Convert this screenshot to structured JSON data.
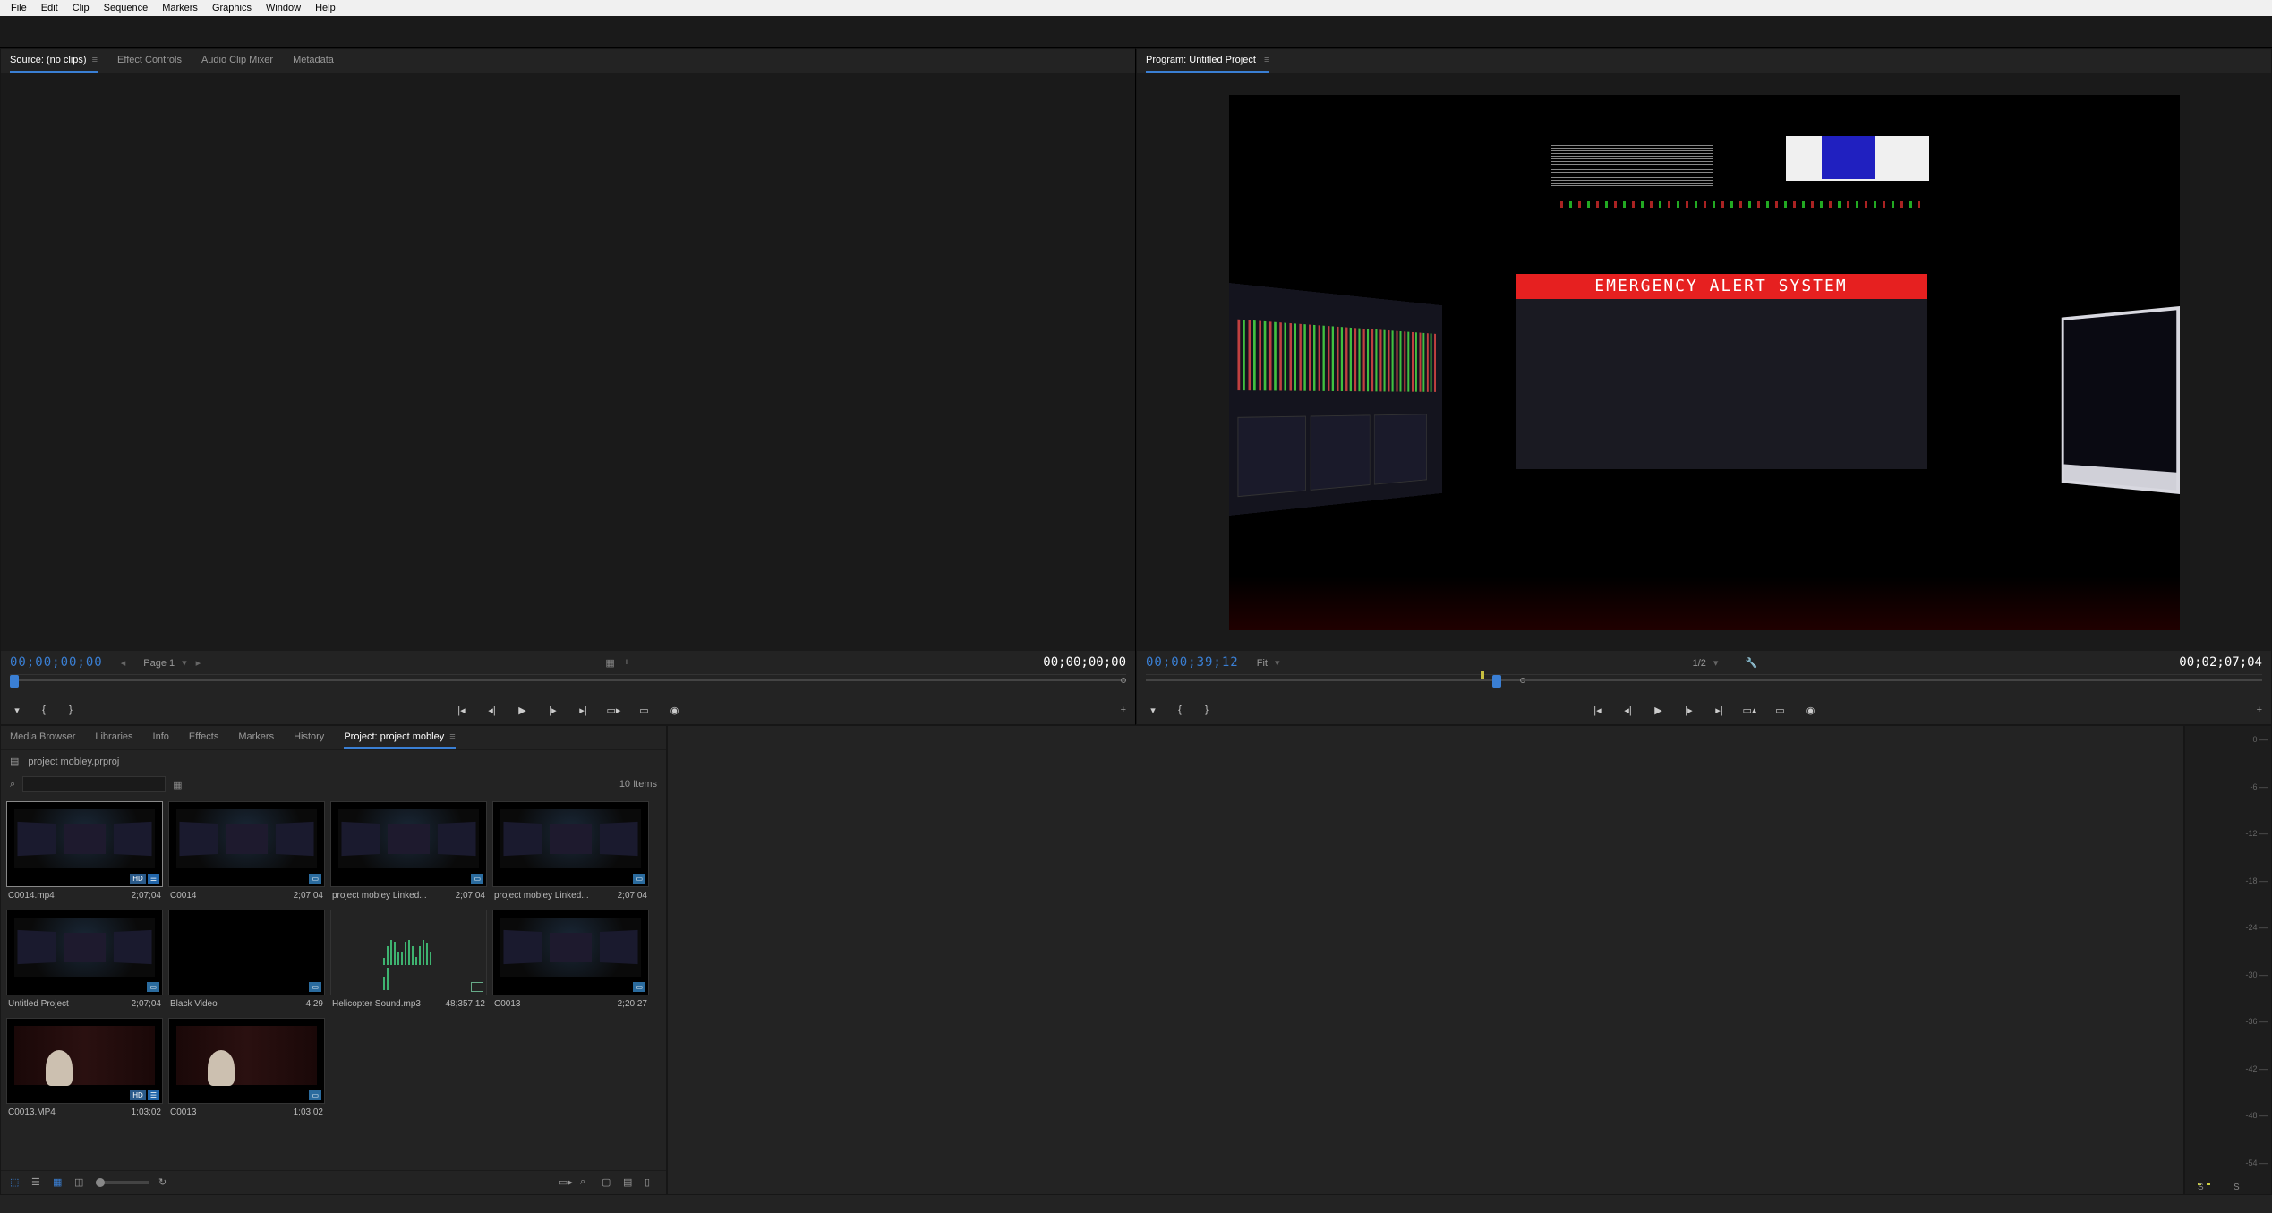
{
  "menubar": [
    "File",
    "Edit",
    "Clip",
    "Sequence",
    "Markers",
    "Graphics",
    "Window",
    "Help"
  ],
  "source_panel": {
    "tabs": [
      {
        "label": "Source: (no clips)",
        "active": true,
        "closeable": true
      },
      {
        "label": "Effect Controls",
        "active": false
      },
      {
        "label": "Audio Clip Mixer",
        "active": false
      },
      {
        "label": "Metadata",
        "active": false
      }
    ],
    "timecode_left": "00;00;00;00",
    "page_label": "Page 1",
    "timecode_right": "00;00;00;00"
  },
  "program_panel": {
    "tab_label": "Program: Untitled Project",
    "timecode_left": "00;00;39;12",
    "fit_label": "Fit",
    "resolution_label": "1/2",
    "timecode_right": "00;02;07;04",
    "alert_text": "EMERGENCY ALERT SYSTEM",
    "playhead_percent": 30
  },
  "lower_tabs": [
    {
      "label": "Media Browser",
      "active": false
    },
    {
      "label": "Libraries",
      "active": false
    },
    {
      "label": "Info",
      "active": false
    },
    {
      "label": "Effects",
      "active": false
    },
    {
      "label": "Markers",
      "active": false
    },
    {
      "label": "History",
      "active": false
    },
    {
      "label": "Project: project mobley",
      "active": true,
      "closeable": true
    }
  ],
  "project": {
    "file_name": "project mobley.prproj",
    "search_placeholder": "",
    "item_count_label": "10 Items",
    "clips": [
      {
        "name": "C0014.mp4",
        "duration": "2;07;04",
        "type": "av",
        "thumb": "scene",
        "selected": true
      },
      {
        "name": "C0014",
        "duration": "2;07;04",
        "type": "seq",
        "thumb": "scene"
      },
      {
        "name": "project mobley Linked...",
        "duration": "2;07;04",
        "type": "seq",
        "thumb": "scene"
      },
      {
        "name": "project mobley Linked...",
        "duration": "2;07;04",
        "type": "seq",
        "thumb": "scene"
      },
      {
        "name": "Untitled Project",
        "duration": "2;07;04",
        "type": "seq",
        "thumb": "scene"
      },
      {
        "name": "Black Video",
        "duration": "4;29",
        "type": "seq",
        "thumb": "black"
      },
      {
        "name": "Helicopter Sound.mp3",
        "duration": "48;357;12",
        "type": "audio",
        "thumb": "wave"
      },
      {
        "name": "C0013",
        "duration": "2;20;27",
        "type": "seq",
        "thumb": "scene"
      },
      {
        "name": "C0013.MP4",
        "duration": "1;03;02",
        "type": "av",
        "thumb": "curtain"
      },
      {
        "name": "C0013",
        "duration": "1;03;02",
        "type": "seq",
        "thumb": "curtain"
      }
    ]
  },
  "meters": {
    "scale": [
      "0",
      "-6",
      "-12",
      "-18",
      "-24",
      "-30",
      "-36",
      "-42",
      "-48",
      "-54"
    ],
    "solo_label": "S"
  }
}
